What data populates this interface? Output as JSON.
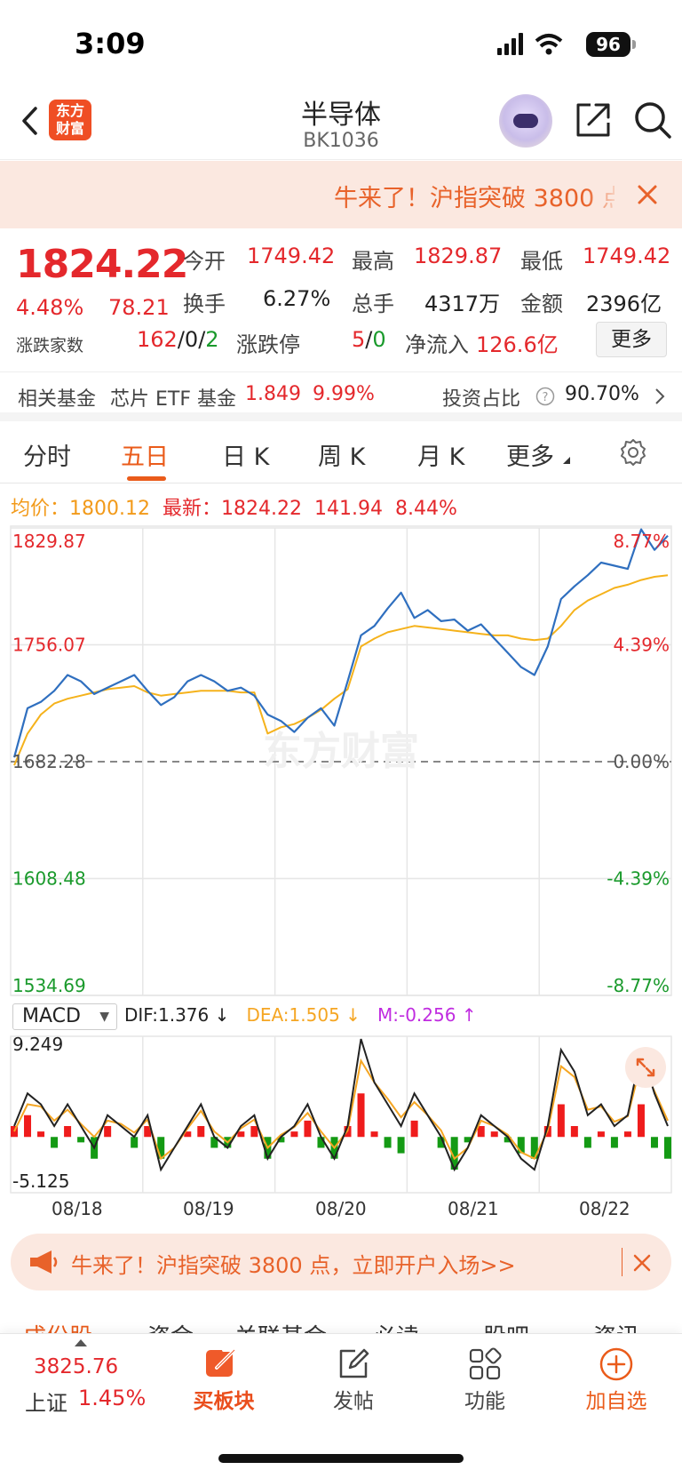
{
  "status_bar": {
    "time": "3:09",
    "battery": "96"
  },
  "header": {
    "back_icon": "chevron-left-icon",
    "logo_text_1": "东方",
    "logo_text_2": "财富",
    "title": "半导体",
    "code": "BK1036"
  },
  "top_banner": {
    "text": "牛来了！沪指突破 3800 点",
    "close_icon": "close-icon"
  },
  "quote": {
    "price": "1824.22",
    "change_pct": "4.48%",
    "change": "78.21",
    "open_label": "今开",
    "open": "1749.42",
    "high_label": "最高",
    "high": "1829.87",
    "low_label": "最低",
    "low": "1749.42",
    "turnover_label": "换手",
    "turnover": "6.27%",
    "volume_label": "总手",
    "volume": "4317万",
    "amount_label": "金额",
    "amount": "2396亿",
    "breadth_label": "涨跌家数",
    "breadth_up": "162",
    "breadth_flat": "0",
    "breadth_down": "2",
    "limit_label": "涨跌停",
    "limit_up": "5",
    "limit_down": "0",
    "inflow_label": "净流入",
    "inflow": "126.6亿",
    "more_label": "更多"
  },
  "fund": {
    "label": "相关基金",
    "name": "芯片 ETF 基金",
    "price": "1.849",
    "pct": "9.99%",
    "ratio_label": "投资占比",
    "ratio": "90.70%"
  },
  "tabs": [
    {
      "label": "分时"
    },
    {
      "label": "五日"
    },
    {
      "label": "日 K"
    },
    {
      "label": "周 K"
    },
    {
      "label": "月 K"
    },
    {
      "label": "更多"
    }
  ],
  "avg_row": {
    "avg_label": "均价：",
    "avg": "1800.12",
    "latest_label": "最新：",
    "latest": "1824.22",
    "latest_change": "141.94",
    "latest_pct": "8.44%"
  },
  "chart_data": {
    "type": "line",
    "title": "",
    "xlabel": "",
    "ylabel": "",
    "categories": [
      "08/18",
      "08/19",
      "08/20",
      "08/21",
      "08/22"
    ],
    "y_ticks_left": [
      "1829.87",
      "1756.07",
      "1682.28",
      "1608.48",
      "1534.69"
    ],
    "y_ticks_right": [
      "8.77%",
      "4.39%",
      "0.00%",
      "-4.39%",
      "-8.77%"
    ],
    "ylim": [
      1534.69,
      1829.87
    ],
    "prev_close": 1682.28,
    "series": [
      {
        "name": "最新",
        "color": "#2f6fbf",
        "values": [
          1685,
          1716,
          1720,
          1727,
          1737,
          1733,
          1725,
          1729,
          1733,
          1737,
          1727,
          1718,
          1723,
          1733,
          1737,
          1733,
          1727,
          1729,
          1724,
          1712,
          1708,
          1701,
          1710,
          1716,
          1705,
          1733,
          1762,
          1768,
          1779,
          1789,
          1773,
          1778,
          1771,
          1772,
          1765,
          1769,
          1760,
          1751,
          1742,
          1737,
          1755,
          1785,
          1793,
          1800,
          1808,
          1806,
          1804,
          1829,
          1816,
          1825
        ]
      },
      {
        "name": "均价",
        "color": "#f5b21b",
        "values": [
          1680,
          1700,
          1712,
          1719,
          1722,
          1724,
          1726,
          1728,
          1729,
          1730,
          1726,
          1724,
          1725,
          1726,
          1727,
          1727,
          1727,
          1726,
          1726,
          1700,
          1704,
          1706,
          1710,
          1715,
          1722,
          1728,
          1755,
          1760,
          1764,
          1766,
          1768,
          1767,
          1766,
          1765,
          1764,
          1763,
          1762,
          1762,
          1760,
          1759,
          1760,
          1768,
          1778,
          1784,
          1788,
          1792,
          1794,
          1797,
          1799,
          1800
        ]
      }
    ]
  },
  "macd": {
    "label": "MACD",
    "dif": "DIF:1.376 ↓",
    "dea": "DEA:1.505 ↓",
    "m": "M:-0.256 ↑",
    "max_label": "9.249",
    "min_label": "-5.125",
    "ylim": [
      -5.125,
      9.249
    ],
    "dif_values": [
      1,
      4,
      3,
      1,
      3,
      1,
      -1,
      2,
      1,
      0,
      2,
      -3,
      -1,
      1,
      3,
      0,
      -1,
      1,
      2,
      -2,
      0,
      1,
      3,
      0,
      -2,
      1,
      9,
      5,
      3,
      1,
      4,
      2,
      0,
      -3,
      -1,
      2,
      1,
      0,
      -2,
      -3,
      1,
      8,
      6,
      2,
      3,
      1,
      2,
      8,
      4,
      1
    ],
    "dea_values": [
      0.5,
      3,
      2.8,
      1.5,
      2.5,
      1.2,
      0,
      1.5,
      1.2,
      0.4,
      1.6,
      -2,
      -1,
      0.8,
      2.4,
      0.5,
      -0.5,
      0.8,
      1.6,
      -1,
      0.2,
      0.9,
      2.2,
      0.5,
      -1,
      0.6,
      7,
      5,
      3.5,
      1.8,
      3.2,
      2,
      0.6,
      -2,
      -1,
      1.5,
      1,
      0.2,
      -1.4,
      -2,
      0.6,
      6.5,
      5.5,
      2.5,
      2.8,
      1.4,
      1.9,
      6.8,
      4.2,
      1.5
    ],
    "hist_values": [
      1,
      2,
      0.5,
      -1,
      1,
      -0.5,
      -2,
      1,
      0,
      -1,
      1,
      -2,
      0,
      0.5,
      1,
      -1,
      -1,
      0.5,
      1,
      -2,
      -0.5,
      0.5,
      1.5,
      -1,
      -2,
      1,
      4,
      0.5,
      -1,
      -1.5,
      1.5,
      0,
      -1,
      -3,
      -0.5,
      1,
      0.5,
      -0.5,
      -1.5,
      -2,
      1,
      3,
      1,
      -1,
      0.5,
      -1,
      0.5,
      3,
      -1,
      -2
    ]
  },
  "promo": {
    "text": "牛来了！沪指突破 3800 点，立即开户入场>>",
    "icon": "megaphone-icon"
  },
  "bottom_tabs_peek": [
    "成份股",
    "资金",
    "关联基金",
    "必读",
    "股吧",
    "资讯"
  ],
  "bottom_nav": {
    "index_value": "3825.76",
    "index_name": "上证",
    "index_pct": "1.45%",
    "items": [
      {
        "label": "买板块",
        "icon": "buy-icon"
      },
      {
        "label": "发帖",
        "icon": "edit-icon"
      },
      {
        "label": "功能",
        "icon": "grid-icon"
      },
      {
        "label": "加自选",
        "icon": "plus-circle-icon"
      }
    ]
  },
  "watermark": "东方财富"
}
